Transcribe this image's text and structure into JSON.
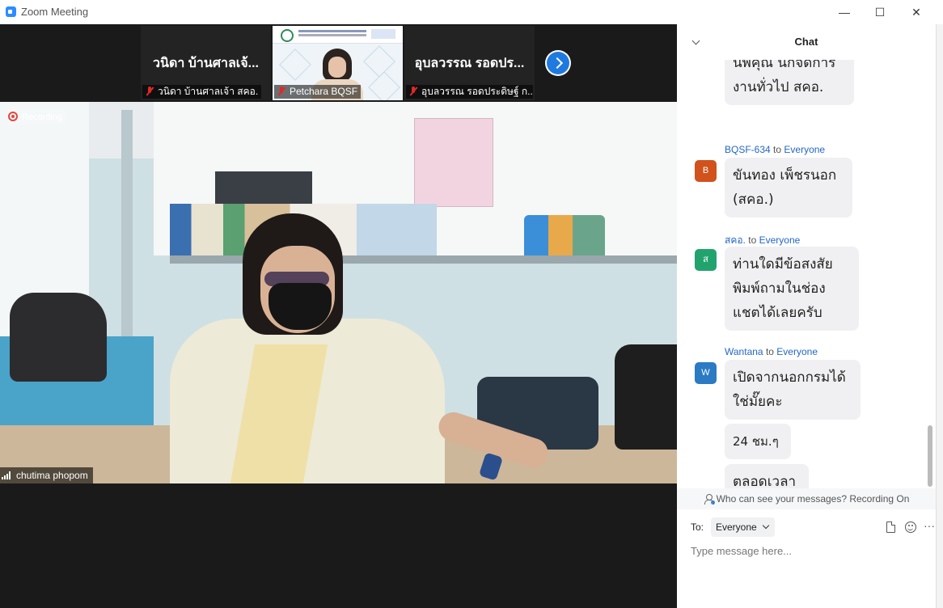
{
  "window": {
    "title": "Zoom Meeting",
    "minimize": "—",
    "maximize": "☐",
    "close": "✕"
  },
  "gallery": {
    "tiles": [
      {
        "display_name": "วนิดา บ้านศาลเจ้...",
        "label": "วนิดา บ้านศาลเจ้า สคอ.",
        "muted": true
      },
      {
        "label": "Petchara BQSF",
        "muted": true,
        "video": true
      },
      {
        "display_name": "อุบลวรรณ รอดปร...",
        "label": "อุบลวรรณ รอดประดิษฐ์ ก...",
        "muted": true
      }
    ],
    "next_icon": "chevron-right-icon"
  },
  "main_video": {
    "recording_label": "Recording",
    "speaker_name": "chutima phopom"
  },
  "chat": {
    "title": "Chat",
    "messages": [
      {
        "text_lines": [
          "นพคุณ นกจดการ",
          "งานทั่วไป สคอ."
        ]
      },
      {
        "sender": "BQSF-634",
        "to_word": "to",
        "recipient": "Everyone",
        "avatar_letter": "B",
        "avatar_color": "#d1521c",
        "bubbles": [
          "ขันทอง เพ็ชรนอก (สคอ.)"
        ]
      },
      {
        "sender": "สคอ.",
        "to_word": "to",
        "recipient": "Everyone",
        "avatar_letter": "ส",
        "avatar_color": "#22a36e",
        "bubbles": [
          "ท่านใดมีข้อสงสัย พิมพ์ถามในช่องแชตได้เลยครับ"
        ]
      },
      {
        "sender": "Wantana",
        "to_word": "to",
        "recipient": "Everyone",
        "avatar_letter": "W",
        "avatar_color": "#2a7bc4",
        "bubbles": [
          "เปิดจากนอกกรมได้ใช่มั๊ยคะ",
          "24 ชม.ๆ",
          "ตลอดเวลา"
        ]
      }
    ],
    "privacy_text": "Who can see your messages? Recording On",
    "to_label": "To:",
    "to_value": "Everyone",
    "input_placeholder": "Type message here...",
    "more_label": "···"
  }
}
